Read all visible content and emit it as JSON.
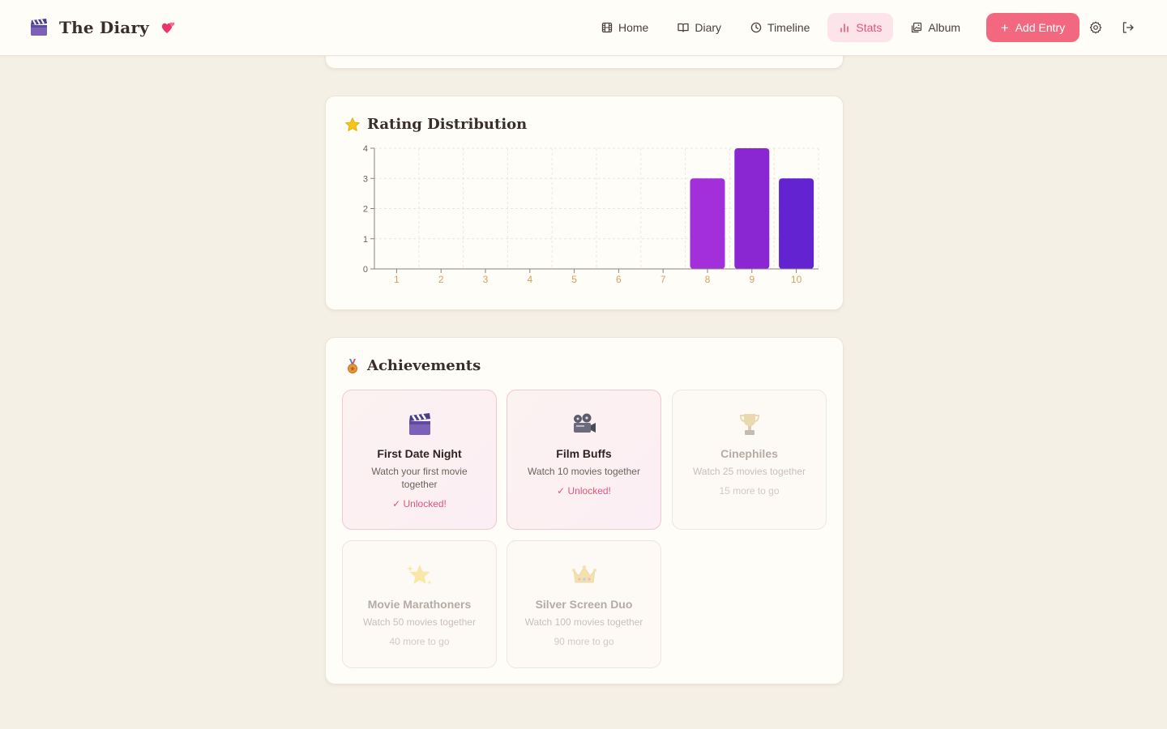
{
  "app": {
    "title": "The Diary",
    "logo_icon": "clapperboard-icon",
    "heart_icon": "heart-icon"
  },
  "nav": {
    "items": [
      {
        "label": "Home",
        "icon": "film-icon"
      },
      {
        "label": "Diary",
        "icon": "book-open-icon"
      },
      {
        "label": "Timeline",
        "icon": "clock-icon"
      },
      {
        "label": "Stats",
        "icon": "bar-chart-icon",
        "active": true
      },
      {
        "label": "Album",
        "icon": "image-icon"
      }
    ],
    "add_entry": "Add Entry"
  },
  "colors": {
    "accent": "#f2697f",
    "active_bg": "#fde3ea",
    "bar_8": "#a22fd9",
    "bar_9": "#8a27d3",
    "bar_10": "#6423d0"
  },
  "rating": {
    "title": "Rating Distribution",
    "icon": "star-icon"
  },
  "chart_data": {
    "type": "bar",
    "categories": [
      "1",
      "2",
      "3",
      "4",
      "5",
      "6",
      "7",
      "8",
      "9",
      "10"
    ],
    "values": [
      0,
      0,
      0,
      0,
      0,
      0,
      0,
      3,
      4,
      3
    ],
    "y_ticks": [
      "0",
      "1",
      "2",
      "3",
      "4"
    ],
    "ylim": [
      0,
      4
    ],
    "grid": true,
    "title": "",
    "xlabel": "",
    "ylabel": ""
  },
  "achievements": {
    "title": "Achievements",
    "icon": "medal-icon",
    "items": [
      {
        "name": "First Date Night",
        "desc": "Watch your first movie together",
        "status": "✓ Unlocked!",
        "unlocked": true,
        "icon": "clapperboard-icon"
      },
      {
        "name": "Film Buffs",
        "desc": "Watch 10 movies together",
        "status": "✓ Unlocked!",
        "unlocked": true,
        "icon": "film-projector-icon"
      },
      {
        "name": "Cinephiles",
        "desc": "Watch 25 movies together",
        "status": "15 more to go",
        "unlocked": false,
        "icon": "trophy-icon"
      },
      {
        "name": "Movie Marathoners",
        "desc": "Watch 50 movies together",
        "status": "40 more to go",
        "unlocked": false,
        "icon": "sparkle-star-icon"
      },
      {
        "name": "Silver Screen Duo",
        "desc": "Watch 100 movies together",
        "status": "90 more to go",
        "unlocked": false,
        "icon": "crown-icon"
      }
    ]
  }
}
